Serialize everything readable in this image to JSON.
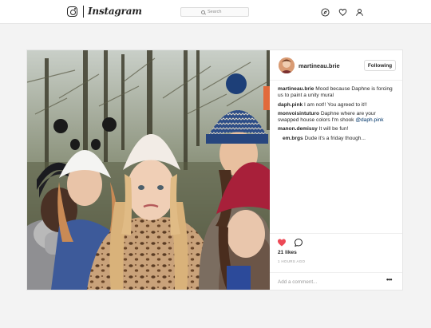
{
  "header": {
    "wordmark": "Instagram",
    "search_placeholder": "Search",
    "icons": [
      "instagram-glyph-icon",
      "explore-compass-icon",
      "heart-icon",
      "profile-icon"
    ]
  },
  "post": {
    "author": "martineau.brie",
    "follow_label": "Following",
    "comments": [
      {
        "user": "martineau.brie",
        "text": "Mood because Daphne is forcing us to paint a unity mural"
      },
      {
        "user": "daph.pink",
        "text": "I am not!! You agreed to it!!"
      },
      {
        "user": "monvoisintuturo",
        "text": "Daphne where are your swapped house colors I'm shook",
        "mention": "@daph.pink"
      },
      {
        "user": "manon.demissy",
        "text": "It will be fun!"
      },
      {
        "user": "em.brgs",
        "text": "Dude it's a friday though..."
      }
    ],
    "likes": "21 likes",
    "time_ago": "1 HOURS AGO",
    "add_comment_placeholder": "Add a comment...",
    "more_label": "•••",
    "liked": true,
    "like_color": "#ed4956"
  }
}
